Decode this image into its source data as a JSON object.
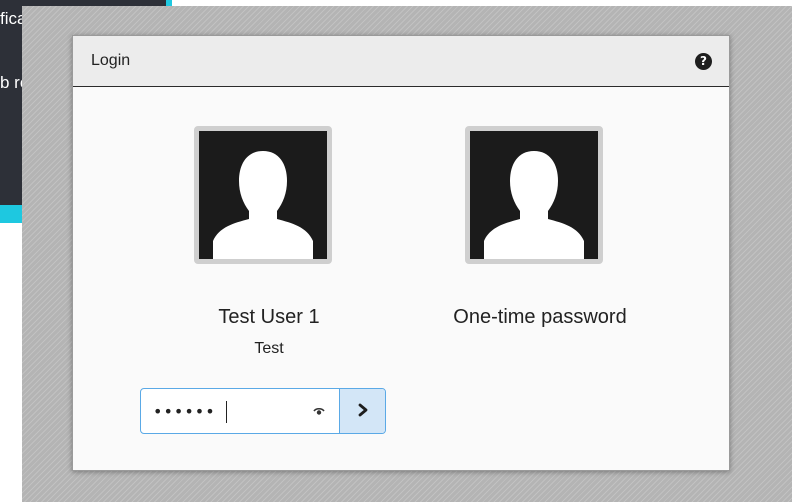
{
  "background": {
    "line1": "fica",
    "line2": "b re"
  },
  "dialog": {
    "title": "Login",
    "help_icon": "question-circle-icon",
    "help_glyph": "?"
  },
  "users": [
    {
      "name": "Test User 1",
      "subtitle": "Test",
      "icon": "user-silhouette-icon"
    },
    {
      "name": "One-time password",
      "subtitle": "",
      "icon": "user-silhouette-icon"
    }
  ],
  "password": {
    "value": "••••••",
    "reveal_icon": "eye-icon",
    "submit_icon": "chevron-right-icon"
  },
  "colors": {
    "accent": "#1ec8e0",
    "input_border": "#5aa9e6",
    "submit_bg": "#d3e6f7"
  }
}
